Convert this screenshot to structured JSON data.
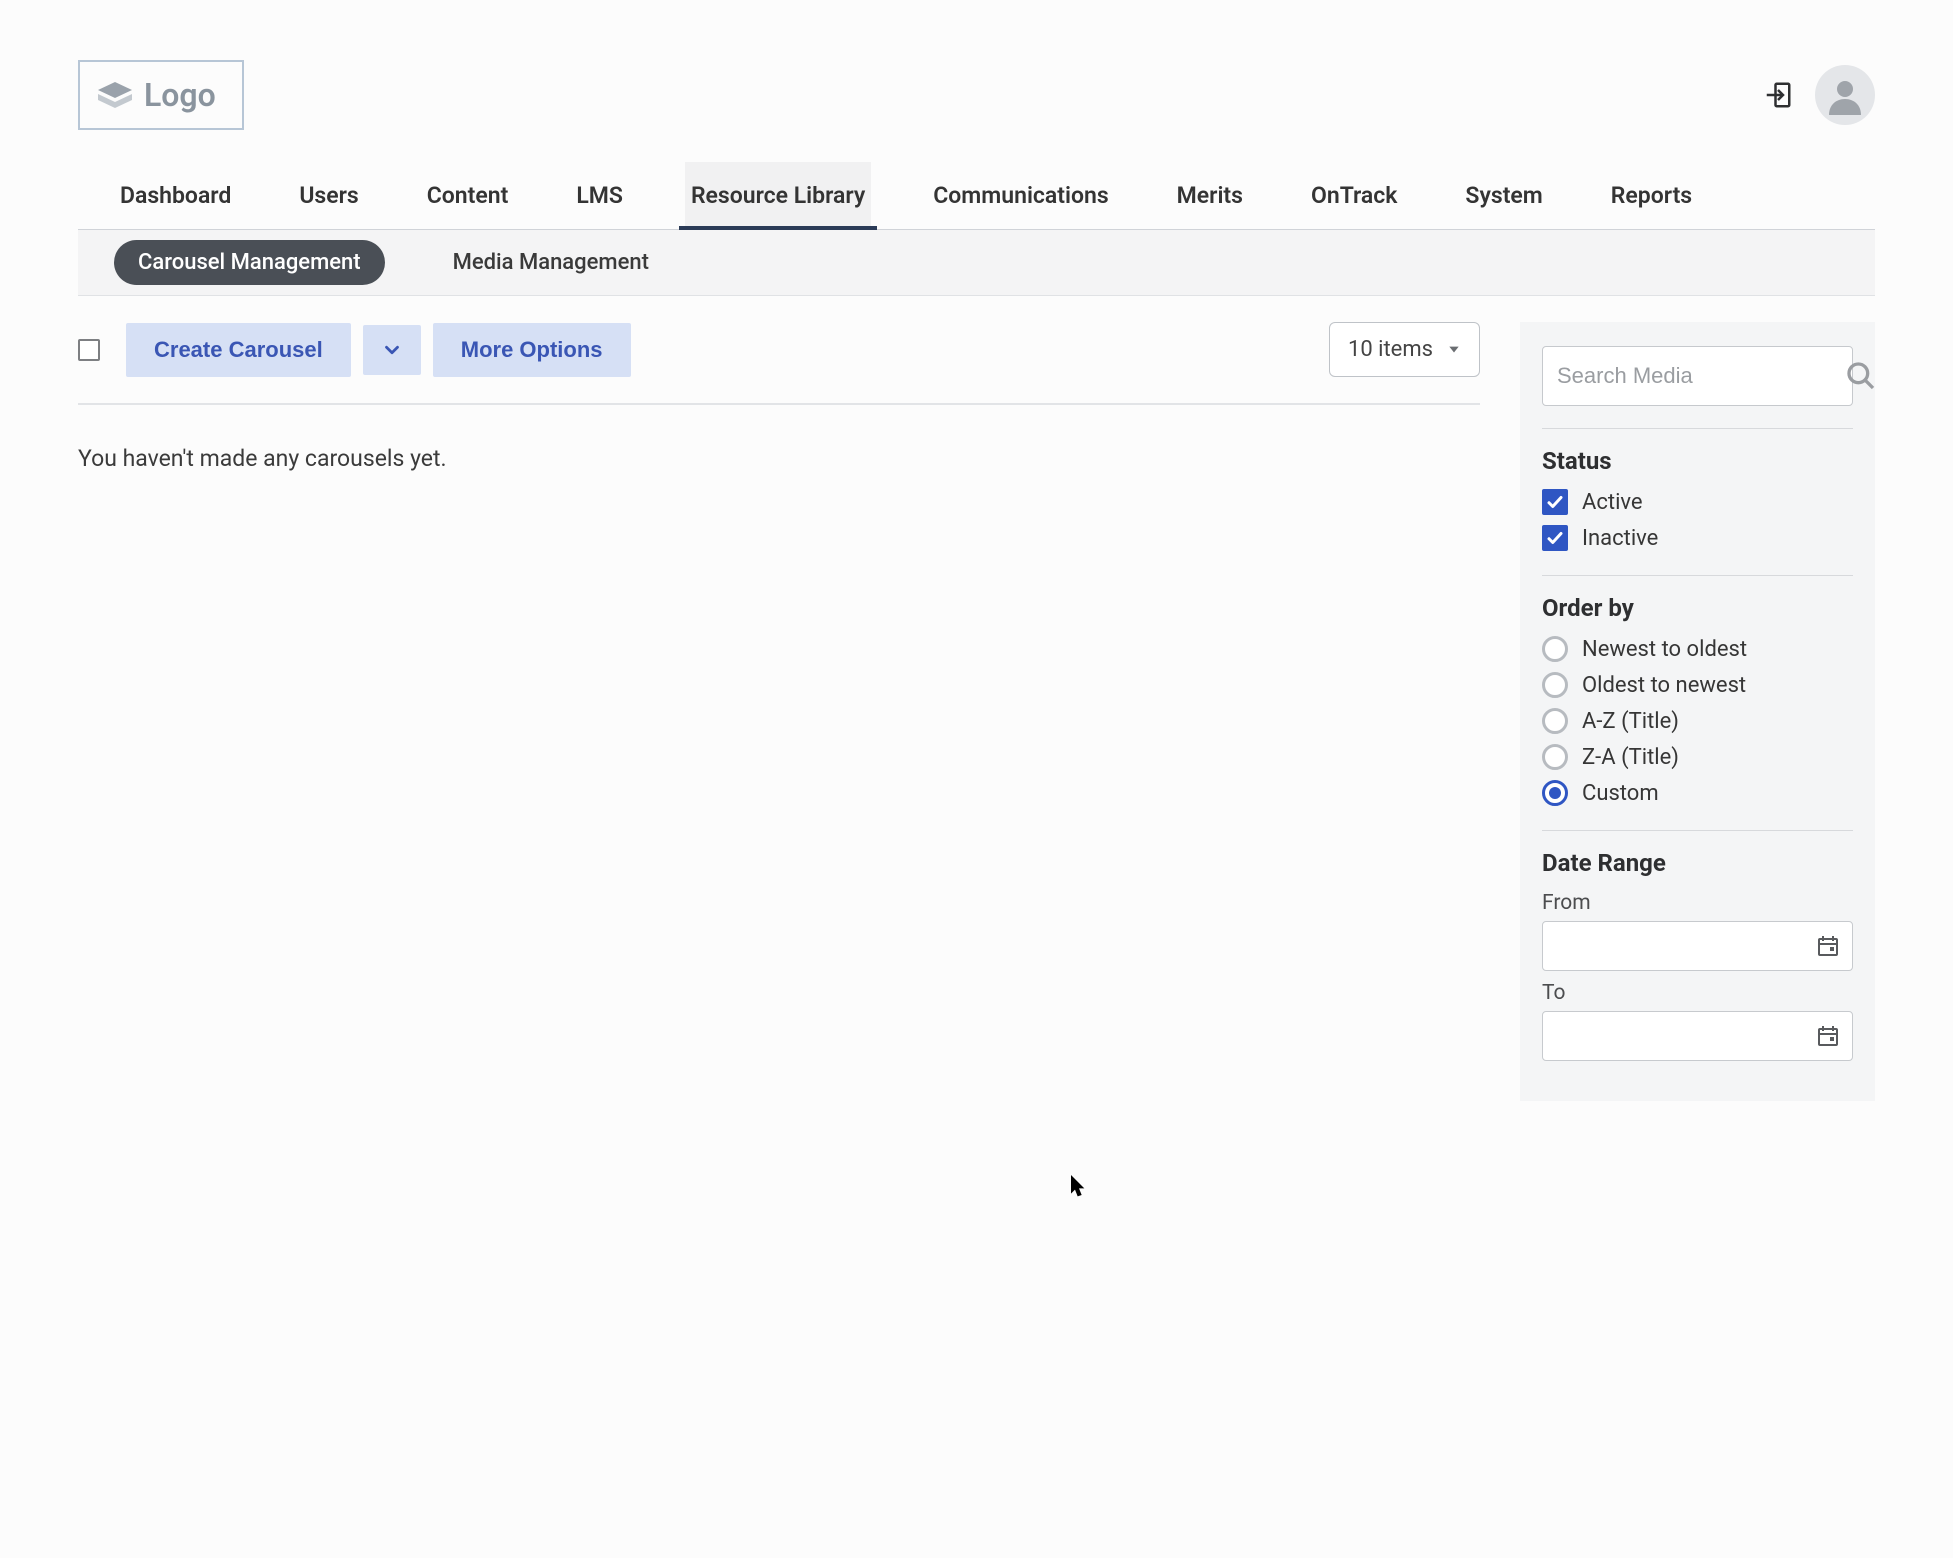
{
  "logo": {
    "text": "Logo"
  },
  "nav": {
    "items": [
      {
        "label": "Dashboard"
      },
      {
        "label": "Users"
      },
      {
        "label": "Content"
      },
      {
        "label": "LMS"
      },
      {
        "label": "Resource Library",
        "active": true
      },
      {
        "label": "Communications"
      },
      {
        "label": "Merits"
      },
      {
        "label": "OnTrack"
      },
      {
        "label": "System"
      },
      {
        "label": "Reports"
      }
    ]
  },
  "subnav": {
    "items": [
      {
        "label": "Carousel Management",
        "active": true
      },
      {
        "label": "Media Management"
      }
    ]
  },
  "toolbar": {
    "create_label": "Create Carousel",
    "more_options_label": "More Options",
    "items_dropdown_label": "10 items"
  },
  "main": {
    "empty_message": "You haven't made any carousels yet."
  },
  "sidebar": {
    "search_placeholder": "Search Media",
    "status": {
      "title": "Status",
      "options": [
        {
          "label": "Active",
          "checked": true
        },
        {
          "label": "Inactive",
          "checked": true
        }
      ]
    },
    "order": {
      "title": "Order by",
      "options": [
        {
          "label": "Newest to oldest",
          "selected": false
        },
        {
          "label": "Oldest to newest",
          "selected": false
        },
        {
          "label": "A-Z (Title)",
          "selected": false
        },
        {
          "label": "Z-A (Title)",
          "selected": false
        },
        {
          "label": "Custom",
          "selected": true
        }
      ]
    },
    "date_range": {
      "title": "Date Range",
      "from_label": "From",
      "to_label": "To",
      "from_value": "",
      "to_value": ""
    }
  }
}
